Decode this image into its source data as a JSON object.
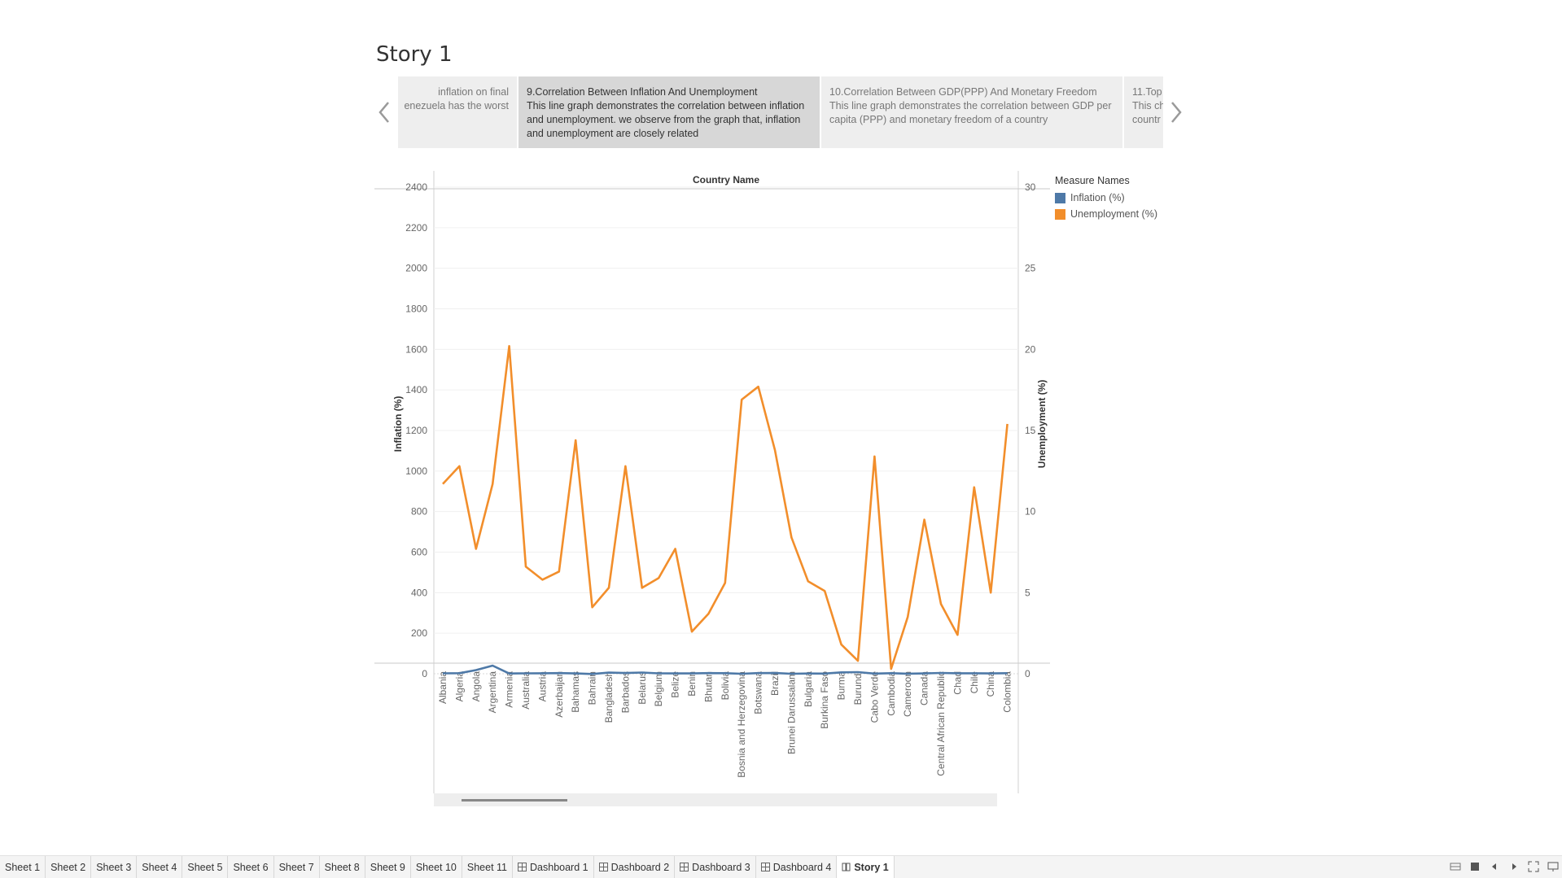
{
  "story": {
    "title": "Story 1"
  },
  "story_points": [
    {
      "caption": "",
      "description": "inflation on final\nenezuela has the worst"
    },
    {
      "caption": "9.Correlation Between Inflation And Unemployment",
      "description": "This line graph demonstrates the correlation between inflation and unemployment. we observe from the graph that, inflation and unemployment are closely related"
    },
    {
      "caption": "10.Correlation Between GDP(PPP) And Monetary Freedom",
      "description": "This line graph demonstrates the correlation between GDP per capita (PPP) and monetary freedom of a country"
    },
    {
      "caption": "11.Top",
      "description": "This ch\ncountr"
    }
  ],
  "legend": {
    "title": "Measure Names",
    "items": [
      {
        "label": "Inflation (%)",
        "color": "#4e79a7"
      },
      {
        "label": "Unemployment (%)",
        "color": "#f28e2b"
      }
    ]
  },
  "chart_data": {
    "type": "line",
    "title": "Country Name",
    "ylabel": "Inflation (%)",
    "y2label": "Unemployment (%)",
    "ylim": [
      0,
      2400
    ],
    "y2lim": [
      0,
      30
    ],
    "yticks": [
      0,
      200,
      400,
      600,
      800,
      1000,
      1200,
      1400,
      1600,
      1800,
      2000,
      2200,
      2400
    ],
    "y2ticks": [
      0,
      5,
      10,
      15,
      20,
      25,
      30
    ],
    "categories": [
      "Albania",
      "Algeria",
      "Angola",
      "Argentina",
      "Armenia",
      "Australia",
      "Austria",
      "Azerbaijan",
      "Bahamas",
      "Bahrain",
      "Bangladesh",
      "Barbados",
      "Belarus",
      "Belgium",
      "Belize",
      "Benin",
      "Bhutan",
      "Bolivia",
      "Bosnia and Herzegovina",
      "Botswana",
      "Brazil",
      "Brunei Darussalam",
      "Bulgaria",
      "Burkina Faso",
      "Burma",
      "Burundi",
      "Cabo Verde",
      "Cambodia",
      "Cameroon",
      "Canada",
      "Central African Republic",
      "Chad",
      "Chile",
      "China",
      "Colombia"
    ],
    "series": [
      {
        "name": "Inflation (%)",
        "axis": "left",
        "color": "#4e79a7",
        "values": [
          2,
          2.9,
          18,
          40,
          1.4,
          2,
          2.3,
          3.2,
          1.5,
          -1.4,
          5.5,
          3.7,
          6.0,
          2.1,
          1.5,
          1.8,
          3.2,
          2.8,
          -0.2,
          3.3,
          3.7,
          0.1,
          1.2,
          1.0,
          6.8,
          8.0,
          0.8,
          2.9,
          0.6,
          1.6,
          4.2,
          2.5,
          2.3,
          1.6,
          2.7
        ]
      },
      {
        "name": "Unemployment (%)",
        "axis": "right",
        "color": "#f28e2b",
        "values": [
          11.7,
          12.8,
          7.7,
          11.7,
          20.2,
          6.6,
          5.8,
          6.3,
          14.4,
          4.1,
          5.3,
          12.8,
          5.3,
          5.9,
          7.7,
          2.6,
          3.7,
          5.6,
          16.9,
          17.7,
          13.8,
          8.4,
          5.7,
          5.1,
          1.8,
          0.8,
          13.4,
          0.3,
          3.5,
          9.5,
          4.3,
          2.4,
          11.5,
          5.0,
          15.4
        ]
      }
    ]
  },
  "scrollbar": {
    "position": 0.05,
    "thumb_fraction": 0.19
  },
  "tabs": [
    {
      "label": "Sheet 1",
      "kind": "sheet"
    },
    {
      "label": "Sheet 2",
      "kind": "sheet"
    },
    {
      "label": "Sheet 3",
      "kind": "sheet"
    },
    {
      "label": "Sheet 4",
      "kind": "sheet"
    },
    {
      "label": "Sheet 5",
      "kind": "sheet"
    },
    {
      "label": "Sheet 6",
      "kind": "sheet"
    },
    {
      "label": "Sheet 7",
      "kind": "sheet"
    },
    {
      "label": "Sheet 8",
      "kind": "sheet"
    },
    {
      "label": "Sheet 9",
      "kind": "sheet"
    },
    {
      "label": "Sheet 10",
      "kind": "sheet"
    },
    {
      "label": "Sheet 11",
      "kind": "sheet"
    },
    {
      "label": "Dashboard 1",
      "kind": "dashboard"
    },
    {
      "label": "Dashboard 2",
      "kind": "dashboard"
    },
    {
      "label": "Dashboard 3",
      "kind": "dashboard"
    },
    {
      "label": "Dashboard 4",
      "kind": "dashboard"
    },
    {
      "label": "Story 1",
      "kind": "story",
      "current": true
    }
  ],
  "tab_controls": [
    "show-sheet-sorter-icon",
    "show-filmstrip-icon",
    "prev-sheet-icon",
    "next-sheet-icon",
    "fullscreen-icon",
    "presentation-mode-icon"
  ],
  "colors": {
    "inflation": "#4e79a7",
    "unemployment": "#f28e2b",
    "active_point": "#d7d7d7",
    "inactive_point": "#eeeeee"
  }
}
